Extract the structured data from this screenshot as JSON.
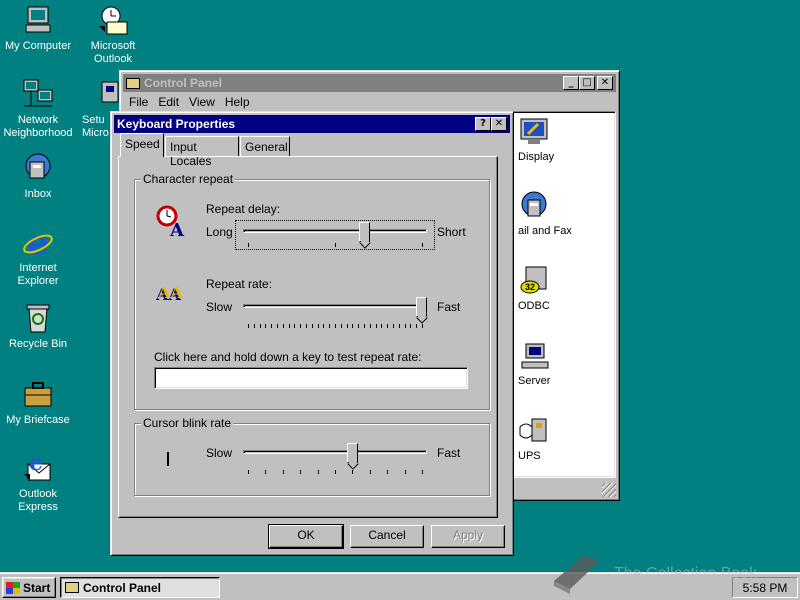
{
  "desktop": {
    "icons": [
      {
        "label": "My Computer",
        "icon": "computer-icon"
      },
      {
        "label": "Microsoft Outlook",
        "icon": "outlook-icon"
      },
      {
        "label": "Network Neighborhood",
        "icon": "network-icon"
      },
      {
        "label": "Inbox",
        "icon": "inbox-icon"
      },
      {
        "label": "Internet Explorer",
        "icon": "ie-icon"
      },
      {
        "label": "Recycle Bin",
        "icon": "recycle-bin-icon"
      },
      {
        "label": "My Briefcase",
        "icon": "briefcase-icon"
      },
      {
        "label": "Outlook Express",
        "icon": "outlook-express-icon"
      },
      {
        "label": "Setu Micro",
        "icon": "setup-icon"
      }
    ]
  },
  "control_panel": {
    "title": "Control Panel",
    "menu": [
      "File",
      "Edit",
      "View",
      "Help"
    ],
    "items": [
      {
        "label": "Display",
        "icon": "display-icon"
      },
      {
        "label": "ail and Fax",
        "icon": "mail-fax-icon"
      },
      {
        "label": "ODBC",
        "icon": "odbc-icon"
      },
      {
        "label": "Server",
        "icon": "server-icon"
      },
      {
        "label": "UPS",
        "icon": "ups-icon"
      }
    ]
  },
  "dialog": {
    "title": "Keyboard Properties",
    "help_glyph": "?",
    "close_glyph": "✕",
    "tabs": [
      "Speed",
      "Input Locales",
      "General"
    ],
    "selected_tab": "Speed",
    "character_repeat": {
      "group_label": "Character repeat",
      "repeat_delay": {
        "label": "Repeat delay:",
        "min_label": "Long",
        "max_label": "Short",
        "level": 0.67
      },
      "repeat_rate": {
        "label": "Repeat rate:",
        "min_label": "Slow",
        "max_label": "Fast",
        "level": 1.0
      },
      "test_label": "Click here and hold down a key to test repeat rate:",
      "test_value": ""
    },
    "cursor_blink": {
      "group_label": "Cursor blink rate",
      "min_label": "Slow",
      "max_label": "Fast",
      "level": 0.6
    },
    "buttons": {
      "ok": "OK",
      "cancel": "Cancel",
      "apply": "Apply"
    }
  },
  "taskbar": {
    "start_label": "Start",
    "task_label": "Control Panel",
    "clock": "5:58 PM"
  },
  "watermark": "The Collection Book",
  "colors": {
    "desktop": "#008080",
    "active_title": "#000080",
    "inactive_title": "#808080",
    "face": "#c0c0c0"
  }
}
